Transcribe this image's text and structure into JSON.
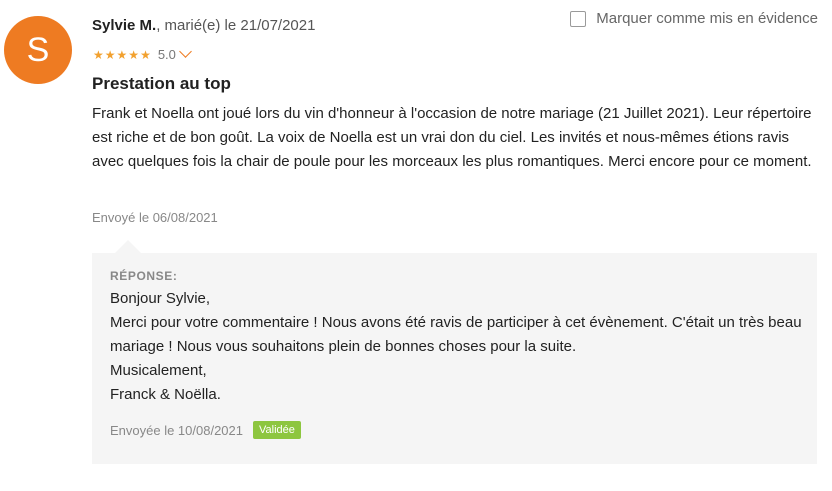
{
  "avatar": {
    "initial": "S",
    "color": "#ee7b22"
  },
  "header": {
    "author": "Sylvie M.",
    "meta": ", marié(e) le 21/07/2021"
  },
  "featured": {
    "label": "Marquer comme mis en évidence",
    "checked": false
  },
  "rating": {
    "value": "5.0",
    "stars": 5,
    "star_color": "#f2a12f",
    "star_icon": "star-icon"
  },
  "review": {
    "title": "Prestation au top",
    "body": "Frank et Noella ont joué lors du vin d'honneur à l'occasion de notre mariage (21 Juillet 2021). Leur répertoire est riche et de bon goût. La voix de Noella est un vrai don du ciel. Les invités et nous-mêmes étions ravis avec quelques fois la chair de poule pour les morceaux les plus romantiques. Merci encore pour ce moment.",
    "sent": "Envoyé le 06/08/2021"
  },
  "response": {
    "label": "RÉPONSE:",
    "lines": [
      "Bonjour Sylvie,",
      "Merci pour votre commentaire ! Nous avons été ravis de participer à cet évènement. C'était un très beau mariage ! Nous vous souhaitons plein de bonnes choses pour la suite.",
      "Musicalement,",
      "Franck & Noëlla."
    ],
    "sent": "Envoyée le 10/08/2021",
    "badge": "Validée",
    "badge_color": "#8dc63f"
  }
}
